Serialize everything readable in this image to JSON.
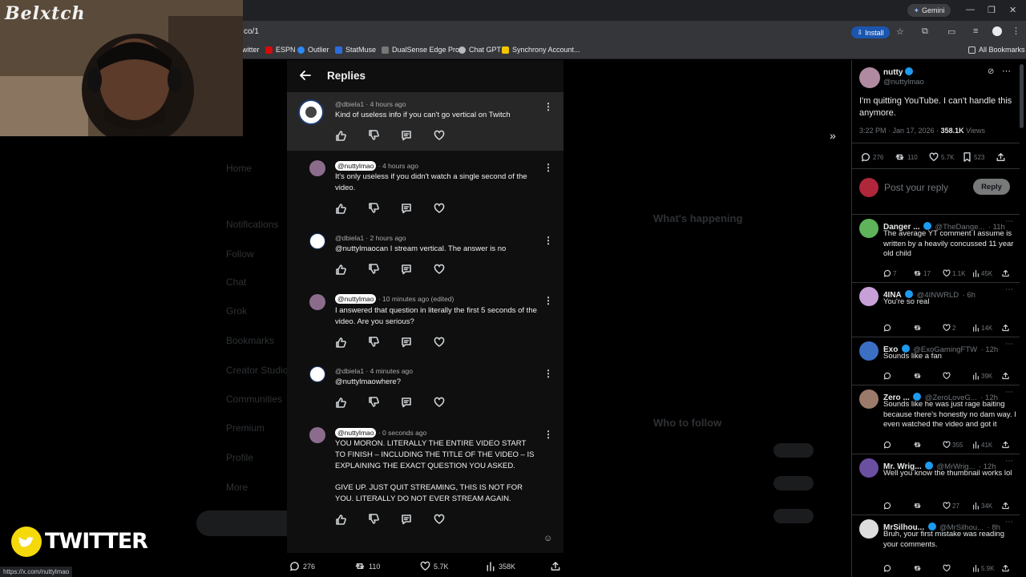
{
  "browser": {
    "url": "co/1",
    "install_label": "Install",
    "gemini_label": "Gemini",
    "bookmarks": [
      "witter",
      "ESPN",
      "Outlier",
      "StatMuse",
      "DualSense Edge Pro...",
      "Chat GPT",
      "Synchrony Account..."
    ],
    "all_bookmarks": "All Bookmarks",
    "status_url": "https://x.com/nuttylmao"
  },
  "webcam": {
    "overlay_name": "Belxtch"
  },
  "overlay": {
    "twitter_label": "TWITTER"
  },
  "replies_panel": {
    "title": "Replies",
    "comments": [
      {
        "handle": "@dbiela1",
        "time": "· 4 hours ago",
        "text": "Kind of useless info if you can't go vertical on Twitch",
        "tagged": false
      },
      {
        "handle": "@nuttylmao",
        "time": "· 4 hours ago",
        "text": "It's only useless if you didn't watch a single second of the video.",
        "tagged": true
      },
      {
        "handle": "@dbiela1",
        "time": "· 2 hours ago",
        "text": "@nuttylmaocan I stream vertical.  The answer is no",
        "tagged": false
      },
      {
        "handle": "@nuttylmao",
        "time": "· 10 minutes ago (edited)",
        "text": "I answered that question in literally the first 5 seconds of the video. Are you serious?",
        "tagged": true
      },
      {
        "handle": "@dbiela1",
        "time": "· 4 minutes ago",
        "text": "@nuttylmaowhere?",
        "tagged": false
      },
      {
        "handle": "@nuttylmao",
        "time": "· 0 seconds ago",
        "text": "YOU MORON. LITERALLY THE ENTIRE VIDEO START TO FINISH – INCLUDING THE TITLE OF THE VIDEO – IS EXPLAINING THE EXACT QUESTION YOU ASKED.",
        "text2": "GIVE UP. JUST QUIT STREAMING, THIS IS NOT FOR YOU. LITERALLY DO NOT EVER STREAM AGAIN.",
        "tagged": true
      }
    ]
  },
  "post_stats_bar": {
    "replies": "276",
    "reposts": "110",
    "likes": "5.7K",
    "views": "358K"
  },
  "tweet": {
    "name": "nutty",
    "handle": "@nuttylmao",
    "text": "I'm quitting YouTube. I can't handle this anymore.",
    "timestamp": "3:22 PM · Jan 17, 2026 ·",
    "views": "358.1K",
    "views_label": "Views",
    "stats": {
      "replies": "276",
      "reposts": "110",
      "likes": "5.7K",
      "bookmarks": "523"
    },
    "reply_placeholder": "Post your reply",
    "reply_button": "Reply"
  },
  "x_replies": [
    {
      "name": "Danger ...",
      "handle": "@TheDange...",
      "time": "· 11h",
      "text": "The average YT comment I assume is written by a heavily concussed 11 year old child",
      "replies": "7",
      "reposts": "17",
      "likes": "1.1K",
      "views": "45K"
    },
    {
      "name": "4INA",
      "handle": "@4INWRLD",
      "time": "· 6h",
      "text": "You're so real",
      "replies": "",
      "reposts": "",
      "likes": "2",
      "views": "14K"
    },
    {
      "name": "Exo",
      "handle": "@ExoGamingFTW",
      "time": "· 12h",
      "text": "Sounds like a fan",
      "replies": "",
      "reposts": "",
      "likes": "",
      "views": "39K"
    },
    {
      "name": "Zero ...",
      "handle": "@ZeroLoveG...",
      "time": "· 12h",
      "text": "Sounds like he was just rage baiting because there's honestly no dam way. I even watched the video and got it",
      "replies": "",
      "reposts": "",
      "likes": "355",
      "views": "41K"
    },
    {
      "name": "Mr. Wrig...",
      "handle": "@MrWrig...",
      "time": "· 12h",
      "text": "Well you know the thumbnail works lol",
      "replies": "",
      "reposts": "",
      "likes": "27",
      "views": "34K"
    },
    {
      "name": "MrSilhou...",
      "handle": "@MrSilhou...",
      "time": "· 8h",
      "text": "Bruh, your first mistake was reading your comments.",
      "replies": "",
      "reposts": "",
      "likes": "",
      "views": "5.9K"
    }
  ]
}
